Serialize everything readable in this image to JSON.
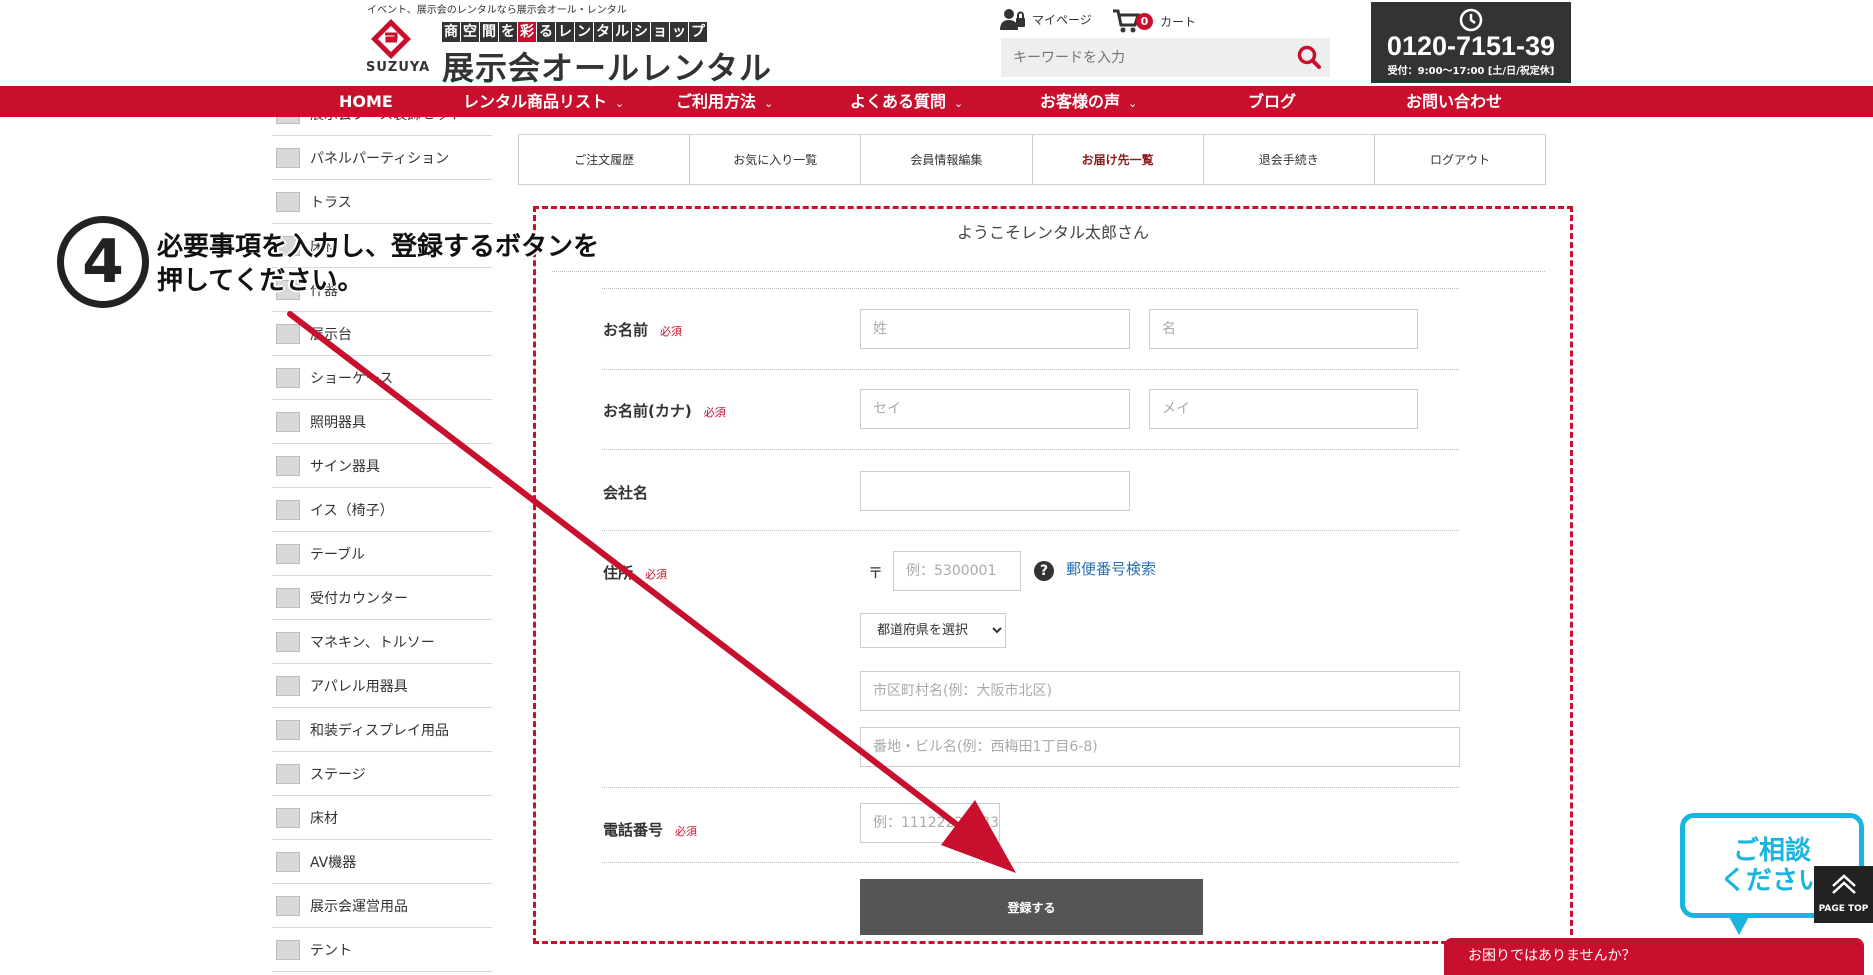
{
  "header": {
    "tagline": "イベント、展示会のレンタルなら展示会オール・レンタル",
    "brand": "SUZUYA",
    "subtitle_parts": [
      {
        "text": "商",
        "accent": false
      },
      {
        "text": "空",
        "accent": false
      },
      {
        "text": "間",
        "accent": false
      },
      {
        "text": "を",
        "accent": false
      },
      {
        "text": "彩",
        "accent": true
      },
      {
        "text": "る",
        "accent": false
      },
      {
        "text": "レ",
        "accent": false
      },
      {
        "text": "ン",
        "accent": false
      },
      {
        "text": "タ",
        "accent": false
      },
      {
        "text": "ル",
        "accent": false
      },
      {
        "text": "シ",
        "accent": false
      },
      {
        "text": "ョ",
        "accent": false
      },
      {
        "text": "ッ",
        "accent": false
      },
      {
        "text": "プ",
        "accent": false
      }
    ],
    "logo_main": "展示会オールレンタル",
    "mypage_label": "マイページ",
    "cart_label": "カート",
    "cart_count": "0",
    "search_placeholder": "キーワードを入力",
    "phone_number": "0120-7151-39",
    "phone_hours": "受付：9:00〜17:00 [土/日/祝定休]"
  },
  "nav": {
    "items": [
      {
        "label": "HOME",
        "has_chevron": false
      },
      {
        "label": "レンタル商品リスト",
        "has_chevron": true
      },
      {
        "label": "ご利用方法",
        "has_chevron": true
      },
      {
        "label": "よくある質問",
        "has_chevron": true
      },
      {
        "label": "お客様の声",
        "has_chevron": true
      },
      {
        "label": "ブログ",
        "has_chevron": false
      },
      {
        "label": "お問い合わせ",
        "has_chevron": false
      }
    ]
  },
  "sidebar": {
    "items": [
      {
        "label": "展示会ブース装飾セット"
      },
      {
        "label": "パネルパーティション"
      },
      {
        "label": "トラス"
      },
      {
        "label": "床材"
      },
      {
        "label": "什器"
      },
      {
        "label": "展示台"
      },
      {
        "label": "ショーケース"
      },
      {
        "label": "照明器具"
      },
      {
        "label": "サイン器具"
      },
      {
        "label": "イス（椅子）"
      },
      {
        "label": "テーブル"
      },
      {
        "label": "受付カウンター"
      },
      {
        "label": "マネキン、トルソー"
      },
      {
        "label": "アパレル用器具"
      },
      {
        "label": "和装ディスプレイ用品"
      },
      {
        "label": "ステージ"
      },
      {
        "label": "床材"
      },
      {
        "label": "AV機器"
      },
      {
        "label": "展示会運営用品"
      },
      {
        "label": "テント"
      }
    ]
  },
  "tabs": [
    {
      "label": "ご注文履歴",
      "active": false
    },
    {
      "label": "お気に入り一覧",
      "active": false
    },
    {
      "label": "会員情報編集",
      "active": false
    },
    {
      "label": "お届け先一覧",
      "active": true
    },
    {
      "label": "退会手続き",
      "active": false
    },
    {
      "label": "ログアウト",
      "active": false
    }
  ],
  "form": {
    "welcome": "ようこそレンタル太郎さん",
    "required_label": "必須",
    "name_label": "お名前",
    "last_name_placeholder": "姓",
    "first_name_placeholder": "名",
    "kana_label": "お名前(カナ)",
    "last_kana_placeholder": "セイ",
    "first_kana_placeholder": "メイ",
    "company_label": "会社名",
    "address_label": "住所",
    "zip_mark": "〒",
    "zip_placeholder": "例：5300001",
    "zip_search_link": "郵便番号検索",
    "prefecture_option": "都道府県を選択",
    "city_placeholder": "市区町村名(例：大阪市北区)",
    "street_placeholder": "番地・ビル名(例：西梅田1丁目6-8)",
    "phone_label": "電話番号",
    "phone_placeholder": "例：11122223333",
    "submit_label": "登録する"
  },
  "annotation": {
    "step_number": "4",
    "instruction_line1": "必要事項を入力し、登録するボタンを",
    "instruction_line2": "押してください。",
    "arrow_color": "#c8102e"
  },
  "widgets": {
    "consult_line1": "ご相談",
    "consult_line2": "ください",
    "page_top_label": "PAGE TOP",
    "help_bar_label": "お困りではありませんか？"
  },
  "colors": {
    "brand_red": "#c8102e",
    "dark": "#333333",
    "link_blue": "#2a6fb5",
    "consult_cyan": "#19b4e0"
  }
}
